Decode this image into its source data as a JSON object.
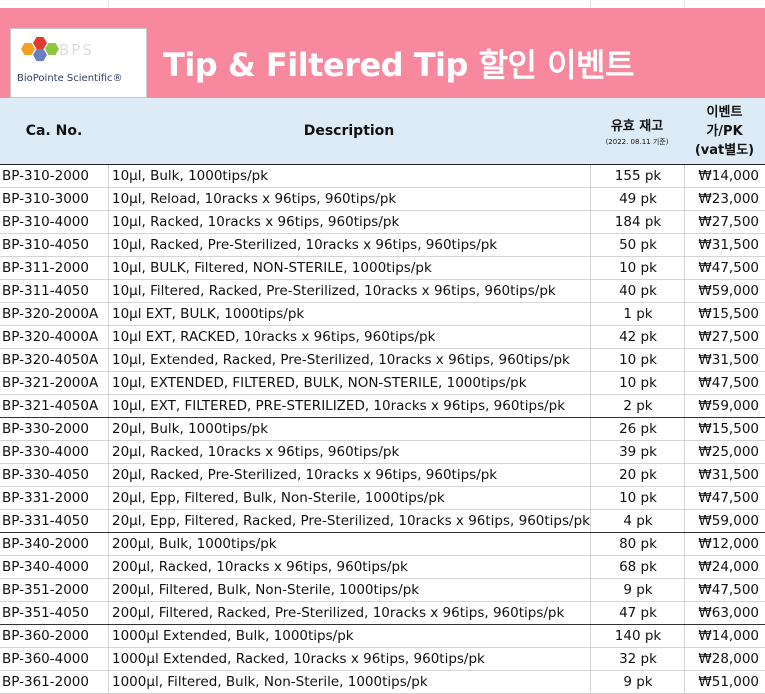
{
  "banner": {
    "logo_text": "BioPointe Scientific®",
    "logo_ghost": "BPS",
    "title": "Tip & Filtered Tip 할인 이벤트",
    "background": "#f7889e"
  },
  "header": {
    "col_code": "Ca. No.",
    "col_desc": "Description",
    "col_stock": "유효 재고",
    "col_stock_sub": "(2022. 08.11 기준)",
    "col_price_l1": "이벤트",
    "col_price_l2": "가/PK",
    "col_price_l3": "(vat별도)",
    "background": "#ddebf7"
  },
  "rows": [
    {
      "code": "BP-310-2000",
      "desc": "10μl, Bulk, 1000tips/pk",
      "stock": "155 pk",
      "price": "₩14,000"
    },
    {
      "code": "BP-310-3000",
      "desc": "10μl, Reload, 10racks x 96tips, 960tips/pk",
      "stock": "49 pk",
      "price": "₩23,000"
    },
    {
      "code": "BP-310-4000",
      "desc": "10μl, Racked, 10racks x 96tips, 960tips/pk",
      "stock": "184 pk",
      "price": "₩27,500"
    },
    {
      "code": "BP-310-4050",
      "desc": "10μl, Racked, Pre-Sterilized, 10racks x 96tips, 960tips/pk",
      "stock": "50 pk",
      "price": "₩31,500"
    },
    {
      "code": "BP-311-2000",
      "desc": "10μl, BULK, Filtered, NON-STERILE, 1000tips/pk",
      "stock": "10 pk",
      "price": "₩47,500"
    },
    {
      "code": "BP-311-4050",
      "desc": "10μl, Filtered, Racked, Pre-Sterilized, 10racks x 96tips, 960tips/pk",
      "stock": "40 pk",
      "price": "₩59,000"
    },
    {
      "code": "BP-320-2000A",
      "desc": "10μl EXT, BULK, 1000tips/pk",
      "stock": "1 pk",
      "price": "₩15,500"
    },
    {
      "code": "BP-320-4000A",
      "desc": "10μl EXT, RACKED, 10racks x 96tips, 960tips/pk",
      "stock": "42 pk",
      "price": "₩27,500"
    },
    {
      "code": "BP-320-4050A",
      "desc": "10μl, Extended, Racked, Pre-Sterilized, 10racks x 96tips, 960tips/pk",
      "stock": "10 pk",
      "price": "₩31,500"
    },
    {
      "code": "BP-321-2000A",
      "desc": "10μl, EXTENDED, FILTERED, BULK, NON-STERILE, 1000tips/pk",
      "stock": "10 pk",
      "price": "₩47,500"
    },
    {
      "code": "BP-321-4050A",
      "desc": "10μl, EXT, FILTERED, PRE-STERILIZED, 10racks x 96tips, 960tips/pk",
      "stock": "2 pk",
      "price": "₩59,000",
      "group_end": true
    },
    {
      "code": "BP-330-2000",
      "desc": "20μl, Bulk, 1000tips/pk",
      "stock": "26 pk",
      "price": "₩15,500"
    },
    {
      "code": "BP-330-4000",
      "desc": "20μl, Racked, 10racks x 96tips, 960tips/pk",
      "stock": "39 pk",
      "price": "₩25,000"
    },
    {
      "code": "BP-330-4050",
      "desc": "20μl, Racked, Pre-Sterilized, 10racks x 96tips, 960tips/pk",
      "stock": "20 pk",
      "price": "₩31,500"
    },
    {
      "code": "BP-331-2000",
      "desc": "20μl, Epp, Filtered, Bulk, Non-Sterile, 1000tips/pk",
      "stock": "10 pk",
      "price": "₩47,500"
    },
    {
      "code": "BP-331-4050",
      "desc": "20μl, Epp, Filtered, Racked, Pre-Sterilized, 10racks x 96tips, 960tips/pk",
      "stock": "4 pk",
      "price": "₩59,000",
      "group_end": true
    },
    {
      "code": "BP-340-2000",
      "desc": "200μl, Bulk, 1000tips/pk",
      "stock": "80 pk",
      "price": "₩12,000"
    },
    {
      "code": "BP-340-4000",
      "desc": "200μl, Racked, 10racks x 96tips, 960tips/pk",
      "stock": "68 pk",
      "price": "₩24,000"
    },
    {
      "code": "BP-351-2000",
      "desc": "200μl, Filtered, Bulk, Non-Sterile, 1000tips/pk",
      "stock": "9 pk",
      "price": "₩47,500"
    },
    {
      "code": "BP-351-4050",
      "desc": "200μl, Filtered, Racked, Pre-Sterilized, 10racks x 96tips, 960tips/pk",
      "stock": "47 pk",
      "price": "₩63,000",
      "group_end": true
    },
    {
      "code": "BP-360-2000",
      "desc": "1000μl Extended, Bulk, 1000tips/pk",
      "stock": "140 pk",
      "price": "₩14,000"
    },
    {
      "code": "BP-360-4000",
      "desc": "1000μl Extended, Racked, 10racks x 96tips, 960tips/pk",
      "stock": "32 pk",
      "price": "₩28,000"
    },
    {
      "code": "BP-361-2000",
      "desc": "1000μl, Filtered, Bulk, Non-Sterile, 1000tips/pk",
      "stock": "9 pk",
      "price": "₩51,000"
    }
  ]
}
